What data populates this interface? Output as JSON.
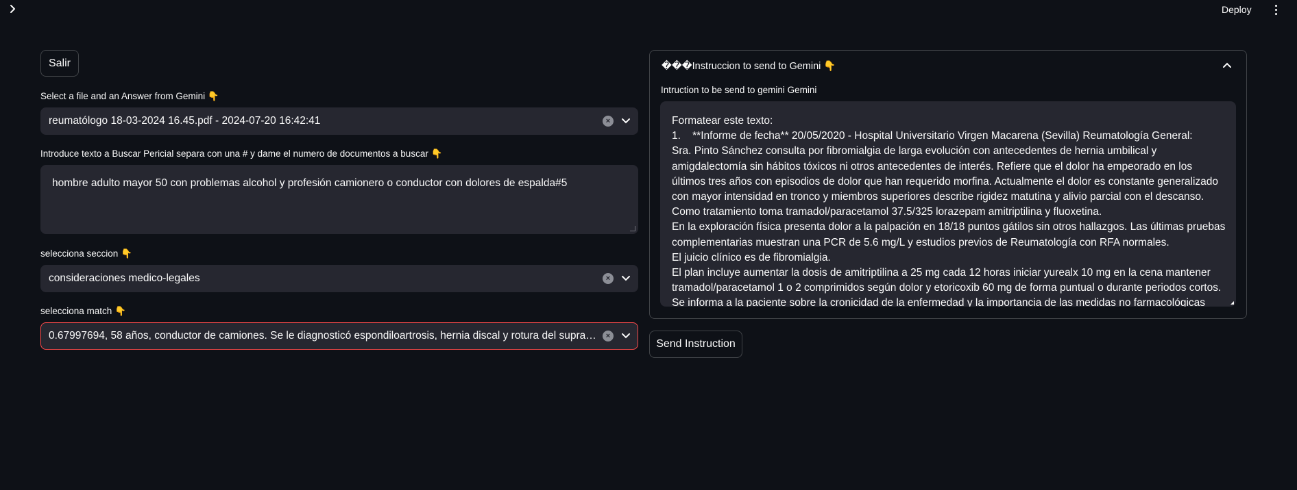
{
  "header": {
    "deploy_label": "Deploy"
  },
  "left": {
    "salir_label": "Salir",
    "file_label": "Select a file and an Answer from Gemini 👇",
    "file_value": "reumatólogo 18-03-2024 16.45.pdf - 2024-07-20 16:42:41",
    "search_label": "Introduce texto a Buscar Pericial separa con una # y dame el numero de documentos a buscar 👇",
    "search_value": "hombre adulto mayor 50 con problemas alcohol  y profesión camionero o conductor con dolores de espalda#5",
    "section_label": "selecciona seccion 👇",
    "section_value": "consideraciones medico-legales",
    "match_label": "selecciona match 👇",
    "match_value": "0.67997694, 58 años, conductor de camiones. Se le diagnosticó espondiloartrosis, hernia discal y rotura del supraespinoso"
  },
  "right": {
    "expander_title": "���Instruccion to send to Gemini 👇",
    "instruction_label": "Intruction to be send to gemini Gemini",
    "instruction_text": "Formatear este texto:\n1.    **Informe de fecha** 20/05/2020 - Hospital Universitario Virgen Macarena (Sevilla) Reumatología General:\nSra. Pinto Sánchez consulta por fibromialgia de larga evolución con antecedentes de hernia umbilical y amigdalectomía sin hábitos tóxicos ni otros antecedentes de interés. Refiere que el dolor ha empeorado en los últimos tres años con episodios de dolor que han requerido morfina. Actualmente el dolor es constante generalizado con mayor intensidad en tronco y miembros superiores describe rigidez matutina y alivio parcial con el descanso. Como tratamiento toma tramadol/paracetamol 37.5/325 lorazepam amitriptilina y fluoxetina.\nEn la exploración física presenta dolor a la palpación en 18/18 puntos gátilos sin otros hallazgos. Las últimas pruebas complementarias muestran una PCR de 5.6 mg/L y estudios previos de Reumatología con RFA normales.\nEl juicio clínico es de fibromialgia.\nEl plan incluye aumentar la dosis de amitriptilina a 25 mg cada 12 horas iniciar yurealx 10 mg en la cena mantener tramadol/paracetamol 1 o 2 comprimidos según dolor y etoricoxib 60 mg de forma puntual o durante periodos cortos.\nSe informa a la paciente sobre la cronicidad de la enfermedad y la importancia de las medidas no farmacológicas como",
    "send_label": "Send Instruction"
  }
}
